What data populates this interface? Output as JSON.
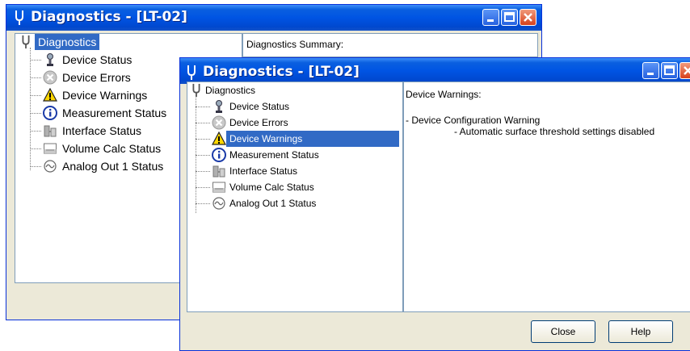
{
  "window_back": {
    "title": "Diagnostics - [LT-02]",
    "right_header": "Diagnostics Summary:",
    "tree": {
      "root": "Diagnostics",
      "items": [
        "Device Status",
        "Device Errors",
        "Device Warnings",
        "Measurement Status",
        "Interface Status",
        "Volume Calc Status",
        "Analog Out 1 Status"
      ]
    }
  },
  "window_front": {
    "title": "Diagnostics - [LT-02]",
    "tree": {
      "root": "Diagnostics",
      "items": [
        "Device Status",
        "Device Errors",
        "Device Warnings",
        "Measurement Status",
        "Interface Status",
        "Volume Calc Status",
        "Analog Out 1 Status"
      ],
      "selected": "Device Warnings"
    },
    "details": {
      "header": "Device Warnings:",
      "line1": "- Device Configuration Warning",
      "line2": "- Automatic surface threshold settings disabled"
    },
    "buttons": {
      "close": "Close",
      "help": "Help"
    }
  },
  "icons": [
    "tuning-fork-icon",
    "probe-icon",
    "error-icon",
    "warning-icon",
    "info-icon",
    "interface-icon",
    "volume-icon",
    "analog-out-icon"
  ],
  "colors": {
    "titlebar": "#0054e3",
    "selection": "#316ac5",
    "close_button": "#d7411d",
    "dialog_bg": "#ece9d8"
  }
}
